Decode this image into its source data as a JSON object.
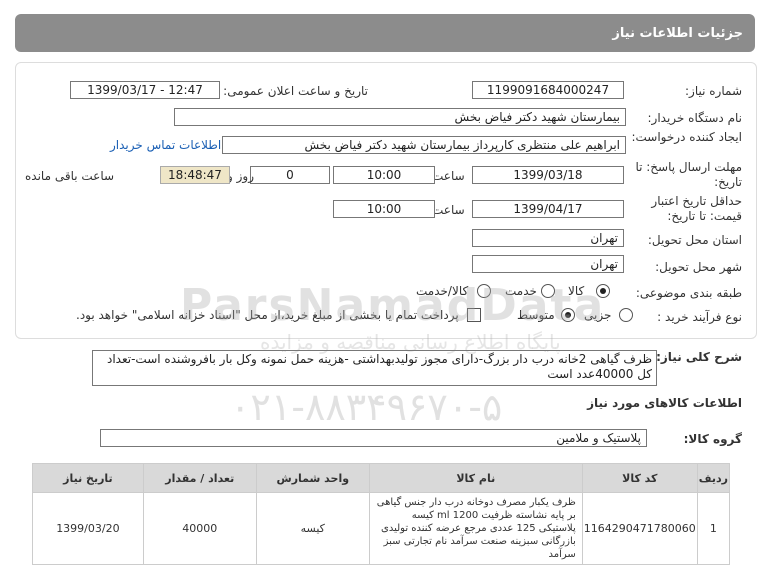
{
  "header": {
    "title": "جزئیات اطلاعات نیاز"
  },
  "form": {
    "need_number_label": "شماره نیاز:",
    "need_number": "1199091684000247",
    "announce_label": "تاریخ و ساعت اعلان عمومی:",
    "announce_value": "1399/03/17 - 12:47",
    "buyer_label": "نام دستگاه خریدار:",
    "buyer_value": "بیمارستان شهید دکتر فیاض بخش",
    "creator_label": "ایجاد کننده درخواست:",
    "creator_value": "ابراهیم علی منتظری کارپرداز بیمارستان شهید دکتر فیاض بخش",
    "contact_link": "اطلاعات تماس خریدار",
    "deadline_label": "مهلت ارسال پاسخ: تا تاریخ:",
    "deadline_date": "1399/03/18",
    "time_label": "ساعت",
    "deadline_time": "10:00",
    "days_value": "0",
    "days_label": "روز و",
    "remaining_time": "18:48:47",
    "remaining_label": "ساعت باقی مانده",
    "validity_label": "حداقل تاریخ اعتبار قیمت: تا تاریخ:",
    "validity_date": "1399/04/17",
    "validity_time": "10:00",
    "province_label": "استان محل تحویل:",
    "province_value": "تهران",
    "city_label": "شهر محل تحویل:",
    "city_value": "تهران",
    "category_label": "طبقه بندی موضوعی:",
    "category_options": [
      "کالا",
      "خدمت",
      "کالا/خدمت"
    ],
    "category_selected": "کالا",
    "process_label": "نوع فرآیند خرید :",
    "process_options": [
      "جزیی",
      "متوسط"
    ],
    "process_selected": "متوسط",
    "payment_note": "پرداخت تمام یا بخشی از مبلغ خرید،از محل \"اسناد خزانه اسلامی\" خواهد بود."
  },
  "description": {
    "label": "شرح کلی نیاز:",
    "text": "ظرف گیاهی 2خانه درب دار بزرگ-دارای مجوز تولیدبهداشتی -هزینه حمل نمونه وکل بار بافروشنده است-تعداد کل 40000عدد است"
  },
  "goods": {
    "section_title": "اطلاعات کالاهای مورد نیاز",
    "group_label": "گروه کالا:",
    "group_value": "پلاستیک و ملامین",
    "columns": [
      "ردیف",
      "کد کالا",
      "نام کالا",
      "واحد شمارش",
      "تعداد / مقدار",
      "تاریخ نیاز"
    ],
    "rows": [
      {
        "row": "1",
        "code": "1164290471780060",
        "name": "ظرف یکبار مصرف دوخانه درب دار جنس گیاهی بر پایه نشاسته ظرفیت ml 1200 کیسه پلاستیکی 125 عددی مرجع عرضه کننده تولیدی بازرگانی سبزینه صنعت سرآمد نام تجارتی سبز سرآمد",
        "unit": "کیسه",
        "qty": "40000",
        "date": "1399/03/20"
      }
    ]
  },
  "watermark": {
    "line1": "ParsNamadData",
    "line2": "پایگاه اطلاع رسانی مناقصه و مزایده",
    "line3": "۰۲۱-۸۸۳۴۹۶۷۰-۵"
  }
}
